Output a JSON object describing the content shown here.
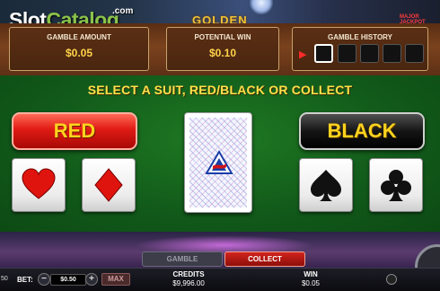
{
  "header": {
    "watermark_main": "Slot",
    "watermark_accent": "Catalog",
    "watermark_suffix": ".com",
    "game_logo": "GOLDEN",
    "jackpot_label": "MAJOR JACKPOT"
  },
  "info": {
    "gamble_amount_label": "GAMBLE AMOUNT",
    "gamble_amount_value": "$0.05",
    "potential_win_label": "POTENTIAL WIN",
    "potential_win_value": "$0.10",
    "gamble_history_label": "GAMBLE HISTORY",
    "history_slots": [
      "",
      "",
      "",
      "",
      ""
    ]
  },
  "gamble": {
    "prompt": "SELECT A SUIT, RED/BLACK OR COLLECT",
    "red_label": "RED",
    "black_label": "BLACK",
    "suits": [
      "heart-icon",
      "diamond-icon",
      "spade-icon",
      "club-icon"
    ],
    "colors": {
      "red": "#e01a14",
      "felt": "#11591a",
      "gold": "#ffd21e"
    }
  },
  "footer": {
    "side_value": "50",
    "tab_gamble": "GAMBLE",
    "tab_collect": "COLLECT",
    "bet_label": "BET:",
    "bet_value": "$0.50",
    "minus": "−",
    "plus": "+",
    "max_label": "MAX",
    "credits_label": "CREDITS",
    "credits_value": "$9,996.00",
    "win_label": "WIN",
    "win_value": "$0.05"
  }
}
